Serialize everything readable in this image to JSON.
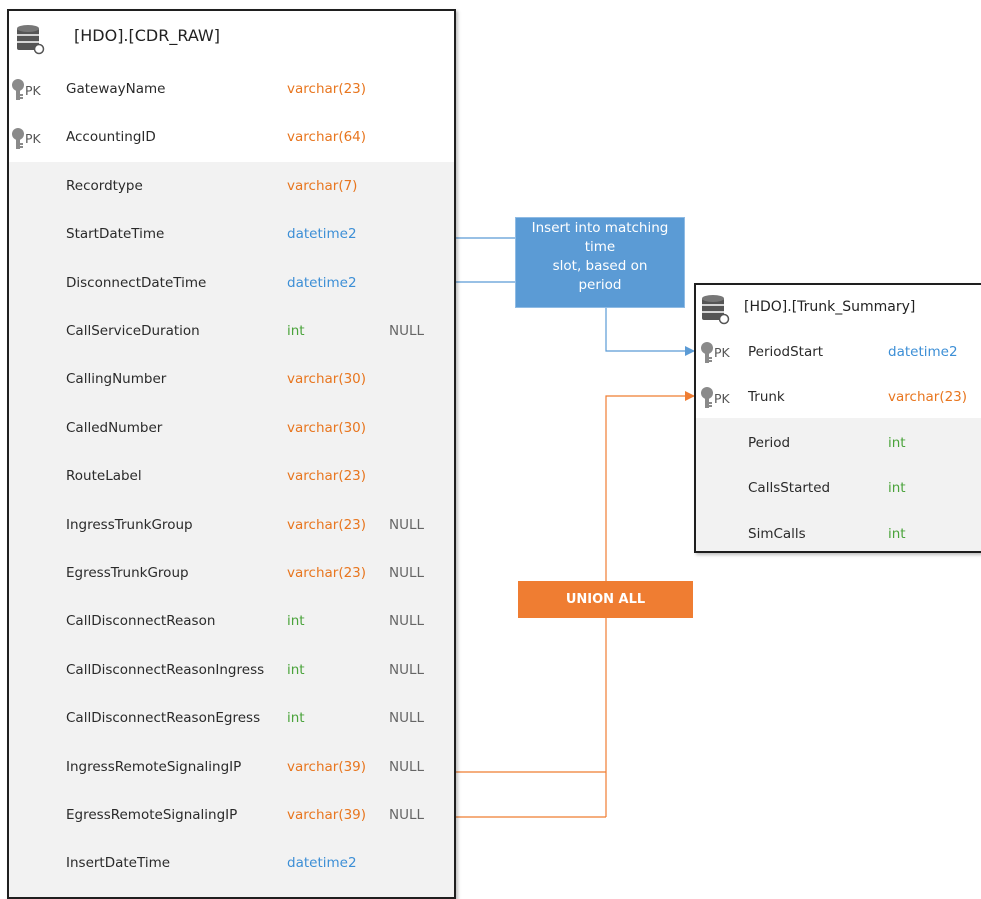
{
  "cdr_raw": {
    "title": "[HDO].[CDR_RAW]",
    "columns": [
      {
        "pk": "PK",
        "name": "GatewayName",
        "type": "varchar(23)",
        "type_color": "orange",
        "null": ""
      },
      {
        "pk": "PK",
        "name": "AccountingID",
        "type": "varchar(64)",
        "type_color": "orange",
        "null": ""
      },
      {
        "pk": "",
        "name": "Recordtype",
        "type": "varchar(7)",
        "type_color": "orange",
        "null": ""
      },
      {
        "pk": "",
        "name": "StartDateTime",
        "type": "datetime2",
        "type_color": "blue",
        "null": ""
      },
      {
        "pk": "",
        "name": "DisconnectDateTime",
        "type": "datetime2",
        "type_color": "blue",
        "null": ""
      },
      {
        "pk": "",
        "name": "CallServiceDuration",
        "type": "int",
        "type_color": "green",
        "null": "NULL"
      },
      {
        "pk": "",
        "name": "CallingNumber",
        "type": "varchar(30)",
        "type_color": "orange",
        "null": ""
      },
      {
        "pk": "",
        "name": "CalledNumber",
        "type": "varchar(30)",
        "type_color": "orange",
        "null": ""
      },
      {
        "pk": "",
        "name": "RouteLabel",
        "type": "varchar(23)",
        "type_color": "orange",
        "null": ""
      },
      {
        "pk": "",
        "name": "IngressTrunkGroup",
        "type": "varchar(23)",
        "type_color": "orange",
        "null": "NULL"
      },
      {
        "pk": "",
        "name": "EgressTrunkGroup",
        "type": "varchar(23)",
        "type_color": "orange",
        "null": "NULL"
      },
      {
        "pk": "",
        "name": "CallDisconnectReason",
        "type": "int",
        "type_color": "green",
        "null": "NULL"
      },
      {
        "pk": "",
        "name": "CallDisconnectReasonIngress",
        "type": "int",
        "type_color": "green",
        "null": "NULL"
      },
      {
        "pk": "",
        "name": "CallDisconnectReasonEgress",
        "type": "int",
        "type_color": "green",
        "null": "NULL"
      },
      {
        "pk": "",
        "name": "IngressRemoteSignalingIP",
        "type": "varchar(39)",
        "type_color": "orange",
        "null": "NULL"
      },
      {
        "pk": "",
        "name": "EgressRemoteSignalingIP",
        "type": "varchar(39)",
        "type_color": "orange",
        "null": "NULL"
      },
      {
        "pk": "",
        "name": "InsertDateTime",
        "type": "datetime2",
        "type_color": "blue",
        "null": ""
      }
    ]
  },
  "trunk_summary": {
    "title": "[HDO].[Trunk_Summary]",
    "columns": [
      {
        "pk": "PK",
        "name": "PeriodStart",
        "type": "datetime2",
        "type_color": "blue"
      },
      {
        "pk": "PK",
        "name": "Trunk",
        "type": "varchar(23)",
        "type_color": "orange"
      },
      {
        "pk": "",
        "name": "Period",
        "type": "int",
        "type_color": "green"
      },
      {
        "pk": "",
        "name": "CallsStarted",
        "type": "int",
        "type_color": "green"
      },
      {
        "pk": "",
        "name": "SimCalls",
        "type": "int",
        "type_color": "green"
      }
    ]
  },
  "notes": {
    "insert_lines": [
      "Insert into matching",
      "time",
      "slot, based on",
      "period"
    ],
    "union": "UNION ALL"
  },
  "colors": {
    "blue_note": "#5b9bd5",
    "orange_note": "#ef7d32",
    "blue_line": "#5b9bd5",
    "orange_line": "#ef7d32",
    "type_orange": "#e8761f",
    "type_blue": "#3d8fd6",
    "type_green": "#4aa33b"
  },
  "icons": [
    "database-icon",
    "primary-key-icon"
  ]
}
